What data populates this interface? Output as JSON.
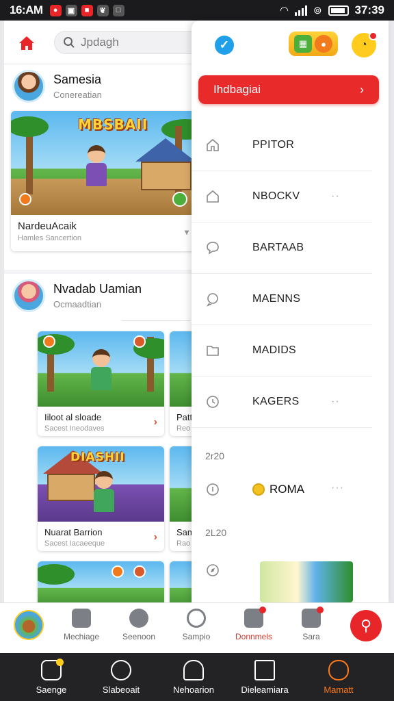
{
  "status_bar": {
    "time": "16:AM",
    "clock": "37:39",
    "notifications": [
      {
        "icon": "red-app-icon",
        "color": "#e8262a"
      },
      {
        "icon": "image-icon",
        "color": "#444"
      },
      {
        "icon": "red-app-icon",
        "color": "#e8262a"
      },
      {
        "icon": "leaf-icon",
        "color": "#444"
      },
      {
        "icon": "square-app-icon",
        "color": "#444"
      }
    ]
  },
  "header": {
    "search_placeholder": "Jpdagh"
  },
  "feed": {
    "post1": {
      "user_name": "Samesia",
      "user_sub": "Conereatian",
      "banner": "MBSBAII",
      "card_title": "NardeuAcaik",
      "card_sub": "Hamles Sancertion"
    },
    "post2": {
      "user_name": "Nvadab Uamian",
      "user_sub": "Ocmaadtian",
      "cards": [
        {
          "title": "Iiloot al sloade",
          "sub": "Sacest Ineodaves",
          "banner": ""
        },
        {
          "title": "Nuarat Barrion",
          "sub": "Sacest Iacaeeque",
          "banner": "DIASHII"
        },
        {
          "title": "",
          "sub": "",
          "banner": ""
        }
      ],
      "right_cards": [
        {
          "title": "Patt",
          "sub": "Reo"
        },
        {
          "title": "Sam",
          "sub": "Rao"
        }
      ]
    }
  },
  "drawer": {
    "cta_label": "Ihdbagiai",
    "menu": [
      {
        "label": "PPITOR",
        "icon": "home-outline-icon",
        "dots": false
      },
      {
        "label": "NBOCKV",
        "icon": "home-outline-icon",
        "dots": true
      },
      {
        "label": "BARTAAB",
        "icon": "chat-bubble-icon",
        "dots": false
      },
      {
        "label": "MAENNS",
        "icon": "message-icon",
        "dots": false
      },
      {
        "label": "MADIDS",
        "icon": "folder-icon",
        "dots": false
      },
      {
        "label": "KAGERS",
        "icon": "clock-icon",
        "dots": true
      }
    ],
    "section1": "2r20",
    "roma_label": "ROMA",
    "section2": "2L20"
  },
  "bottom_nav": [
    {
      "label": "Mechiage",
      "icon": "puzzle-icon",
      "active": false
    },
    {
      "label": "Seenoon",
      "icon": "speech-icon",
      "active": false
    },
    {
      "label": "Sampio",
      "icon": "gear-circle-icon",
      "active": false
    },
    {
      "label": "Donnmels",
      "icon": "gift-icon",
      "active": true
    },
    {
      "label": "Sara",
      "icon": "robot-icon",
      "active": false
    }
  ],
  "tab_bar": [
    {
      "label": "Saenge",
      "icon": "home-icon",
      "active": false
    },
    {
      "label": "Slabeoait",
      "icon": "search-person-icon",
      "active": false
    },
    {
      "label": "Nehoarion",
      "icon": "helmet-icon",
      "active": false
    },
    {
      "label": "Dieleamiara",
      "icon": "list-icon",
      "active": false
    },
    {
      "label": "Mamatt",
      "icon": "profile-icon",
      "active": true
    }
  ],
  "colors": {
    "accent_red": "#e8262a",
    "accent_orange": "#ff7a1a",
    "accent_yellow": "#ffcc1e",
    "check_blue": "#1fa0e8"
  }
}
